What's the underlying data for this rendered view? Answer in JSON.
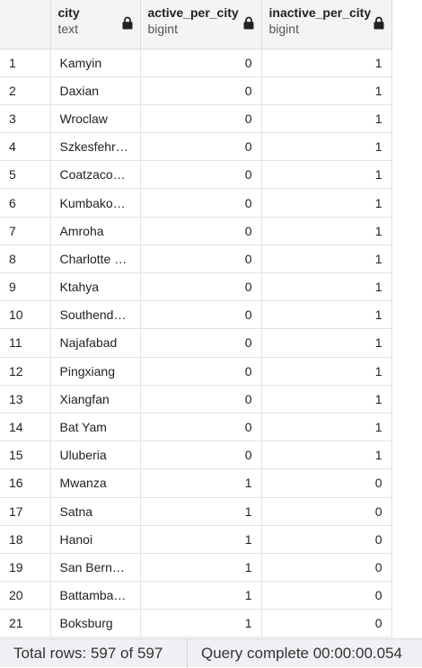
{
  "columns": [
    {
      "name": "city",
      "type": "text"
    },
    {
      "name": "active_per_city",
      "type": "bigint"
    },
    {
      "name": "inactive_per_city",
      "type": "bigint"
    }
  ],
  "icons": {
    "column_lock": "lock-icon"
  },
  "rows": [
    {
      "n": "1",
      "city": "Kamyin",
      "active": "0",
      "inactive": "1"
    },
    {
      "n": "2",
      "city": "Daxian",
      "active": "0",
      "inactive": "1"
    },
    {
      "n": "3",
      "city": "Wroclaw",
      "active": "0",
      "inactive": "1"
    },
    {
      "n": "4",
      "city": "Szkesfehr…",
      "active": "0",
      "inactive": "1"
    },
    {
      "n": "5",
      "city": "Coatzaco…",
      "active": "0",
      "inactive": "1"
    },
    {
      "n": "6",
      "city": "Kumbako…",
      "active": "0",
      "inactive": "1"
    },
    {
      "n": "7",
      "city": "Amroha",
      "active": "0",
      "inactive": "1"
    },
    {
      "n": "8",
      "city": "Charlotte …",
      "active": "0",
      "inactive": "1"
    },
    {
      "n": "9",
      "city": "Ktahya",
      "active": "0",
      "inactive": "1"
    },
    {
      "n": "10",
      "city": "Southend…",
      "active": "0",
      "inactive": "1"
    },
    {
      "n": "11",
      "city": "Najafabad",
      "active": "0",
      "inactive": "1"
    },
    {
      "n": "12",
      "city": "Pingxiang",
      "active": "0",
      "inactive": "1"
    },
    {
      "n": "13",
      "city": "Xiangfan",
      "active": "0",
      "inactive": "1"
    },
    {
      "n": "14",
      "city": "Bat Yam",
      "active": "0",
      "inactive": "1"
    },
    {
      "n": "15",
      "city": "Uluberia",
      "active": "0",
      "inactive": "1"
    },
    {
      "n": "16",
      "city": "Mwanza",
      "active": "1",
      "inactive": "0"
    },
    {
      "n": "17",
      "city": "Satna",
      "active": "1",
      "inactive": "0"
    },
    {
      "n": "18",
      "city": "Hanoi",
      "active": "1",
      "inactive": "0"
    },
    {
      "n": "19",
      "city": "San Bern…",
      "active": "1",
      "inactive": "0"
    },
    {
      "n": "20",
      "city": "Battamba…",
      "active": "1",
      "inactive": "0"
    },
    {
      "n": "21",
      "city": "Boksburg",
      "active": "1",
      "inactive": "0"
    }
  ],
  "status": {
    "total_rows": "Total rows: 597 of 597",
    "query": "Query complete 00:00:00.054"
  },
  "colors": {
    "header_bg": "#f3f4f6",
    "grid_line": "#e1e3e7",
    "status_bg": "#eef0f3"
  }
}
